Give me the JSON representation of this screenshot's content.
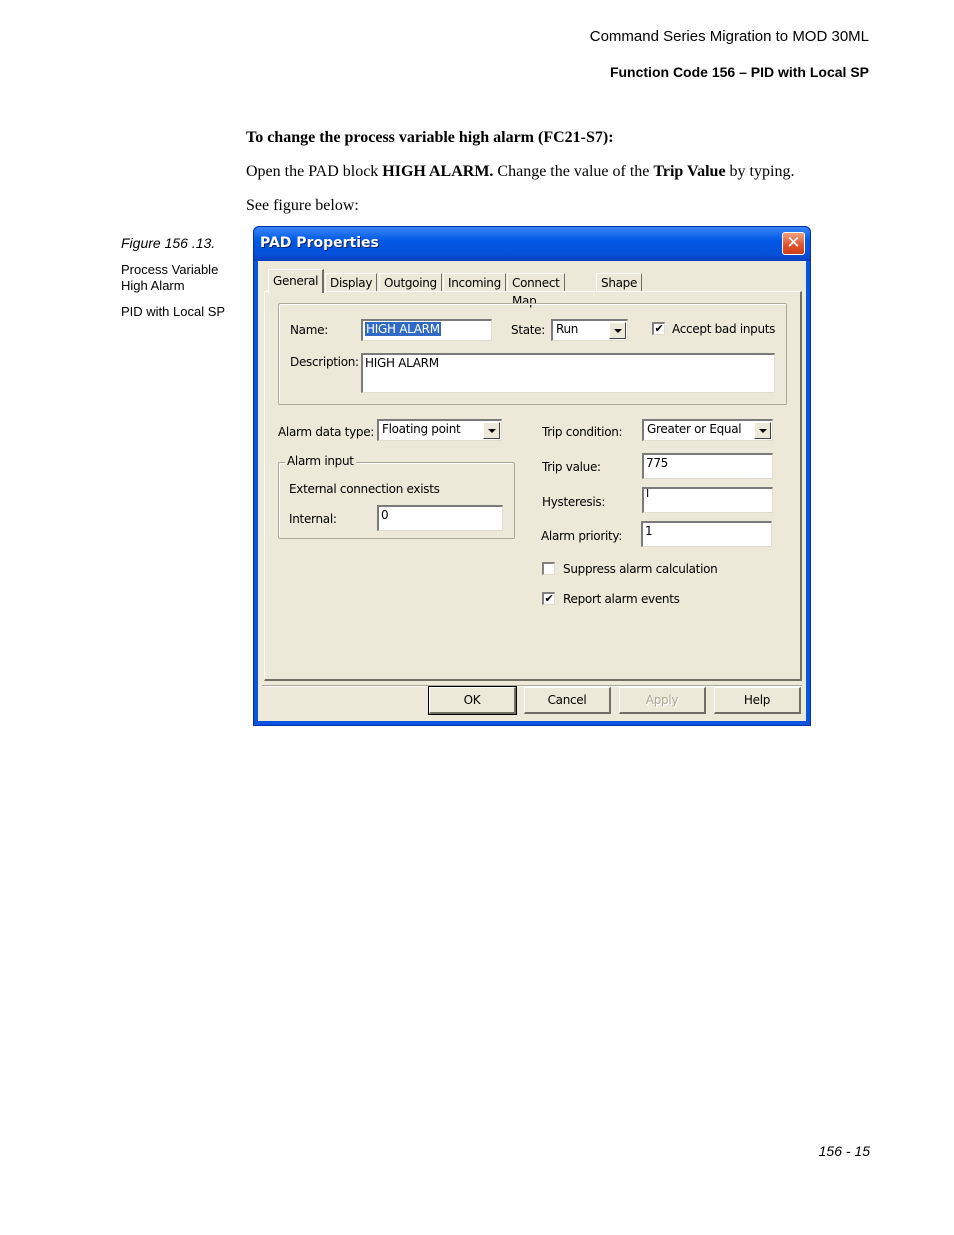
{
  "page_header": {
    "line1": "Command Series Migration to MOD 30ML",
    "line2": "Function Code 156 – PID with Local SP"
  },
  "body": {
    "heading": "To change the process variable high alarm (FC21-S7):",
    "para1_prefix": "Open the PAD block ",
    "para1_bold1": "HIGH ALARM.",
    "para1_mid": " Change the value of the ",
    "para1_bold2": "Trip Value",
    "para1_suffix": " by typing.",
    "para2": "See figure below:"
  },
  "caption": {
    "figure": "Figure 156 .13.",
    "title_line1": "Process Variable",
    "title_line2": "High Alarm",
    "subtitle": "PID with Local SP"
  },
  "dialog": {
    "title": "PAD Properties",
    "close_glyph": "✕",
    "tabs": [
      {
        "label": "General",
        "active": true
      },
      {
        "label": "Display",
        "active": false
      },
      {
        "label": "Outgoing",
        "active": false
      },
      {
        "label": "Incoming",
        "active": false
      },
      {
        "label": "Connect Map",
        "active": false
      },
      {
        "label": "Shape",
        "active": false
      }
    ],
    "name_label": "Name:",
    "name_value": "HIGH ALARM",
    "state_label": "State:",
    "state_value": "Run",
    "accept_bad_inputs_label": "Accept bad inputs",
    "accept_bad_inputs_checked": true,
    "description_label": "Description:",
    "description_value": "HIGH ALARM",
    "alarm_data_type_label": "Alarm data type:",
    "alarm_data_type_value": "Floating point",
    "alarm_input_group": "Alarm input",
    "external_connection_text": "External connection exists",
    "internal_label": "Internal:",
    "internal_value": "0",
    "trip_condition_label": "Trip condition:",
    "trip_condition_value": "Greater or Equal",
    "trip_value_label": "Trip value:",
    "trip_value": "775",
    "hysteresis_label": "Hysteresis:",
    "hysteresis_value": "",
    "alarm_priority_label": "Alarm priority:",
    "alarm_priority_value": "1",
    "suppress_label": "Suppress alarm calculation",
    "suppress_checked": false,
    "report_label": "Report alarm events",
    "report_checked": true,
    "check_glyph": "✔",
    "cursor_glyph": "I",
    "buttons": {
      "ok": "OK",
      "cancel": "Cancel",
      "apply": "Apply",
      "help": "Help"
    }
  },
  "page_number": "156 - 15"
}
